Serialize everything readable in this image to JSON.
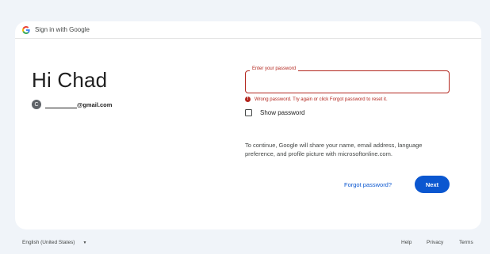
{
  "header": {
    "title": "Sign in with Google"
  },
  "account": {
    "greeting": "Hi Chad",
    "avatar_initial": "C",
    "email_suffix": "@gmail.com"
  },
  "password": {
    "label": "Enter your password",
    "value": "",
    "error": "Wrong password. Try again or click Forgot password to reset it.",
    "show_password_label": "Show password",
    "show_password_checked": false
  },
  "consent_text": "To continue, Google will share your name, email address, language preference, and profile picture with microsoftonline.com.",
  "actions": {
    "forgot_label": "Forgot password?",
    "next_label": "Next"
  },
  "footer": {
    "language": "English (United States)",
    "help": "Help",
    "privacy": "Privacy",
    "terms": "Terms"
  },
  "colors": {
    "brand_blue": "#0b57d0",
    "error_red": "#b3261e",
    "background": "#f0f4f9"
  }
}
